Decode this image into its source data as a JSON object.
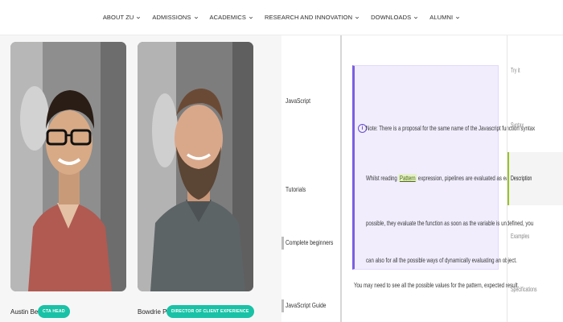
{
  "nav": {
    "items": [
      {
        "label": "ABOUT ZU"
      },
      {
        "label": "ADMISSIONS"
      },
      {
        "label": "ACADEMICS"
      },
      {
        "label": "RESEARCH AND INNOVATION"
      },
      {
        "label": "DOWNLOADS"
      },
      {
        "label": "ALUMNI"
      }
    ]
  },
  "profiles": [
    {
      "name": "Austin Belzer",
      "role": "CTA HEAD",
      "shirt_color": "#b05a52",
      "bg_color": "#8e8e8e"
    },
    {
      "name": "Bowdrie Price",
      "role": "DIRECTOR OF CLIENT EXPERIENCE",
      "shirt_color": "#5d6466",
      "bg_color": "#7d7d7d"
    }
  ],
  "docs": {
    "sidebar": [
      {
        "label": "JavaScript"
      },
      {
        "label": "Tutorials"
      },
      {
        "label": "Complete beginners"
      },
      {
        "label": "JavaScript Guide"
      }
    ],
    "note": {
      "icon": "info-icon",
      "line1": "Note: There is a proposal for the same name of the Javascript function syntax",
      "line2_prefix": "Whilst reading",
      "line2_code": "Pattern",
      "line2_suffix": "expression, pipelines are evaluated as early as",
      "line3": "possible, they evaluate the function as soon as the variable is undefined, you",
      "line4": "can also for all the possible ways of dynamically evaluating an object."
    },
    "below": "You may need to see all the possible values for the pattern, expected result.",
    "toc": [
      {
        "label": "Try it"
      },
      {
        "label": "Syntax"
      },
      {
        "label": "Description"
      },
      {
        "label": "Examples"
      },
      {
        "label": "Specifications"
      }
    ],
    "toc_active_index": 2
  },
  "colors": {
    "badge": "#19c2a6",
    "note_accent": "#7b5fe0",
    "toc_active": "#9ac22a"
  }
}
